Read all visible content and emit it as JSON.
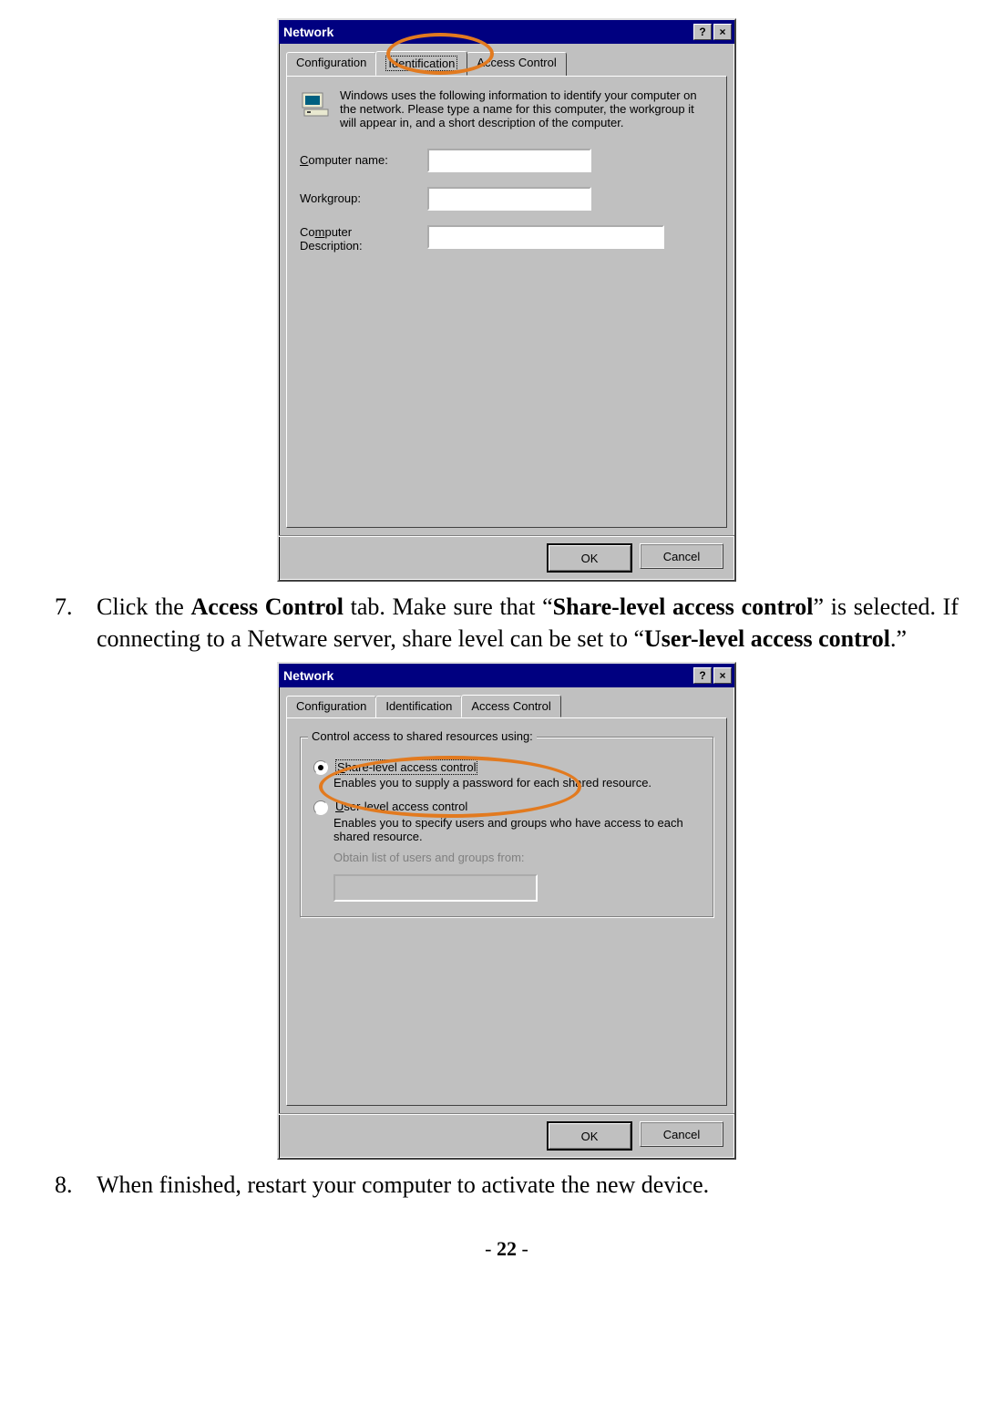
{
  "dlg1": {
    "title": "Network",
    "help_glyph": "?",
    "close_glyph": "×",
    "tabs": {
      "config": "Configuration",
      "ident": "Identification",
      "access": "Access Control"
    },
    "desc": "Windows uses the following information to identify your computer on the network.  Please type a name for this computer, the workgroup it will appear in, and a short description of the computer.",
    "fields": {
      "computer_name_pre": "C",
      "computer_name_rest": "omputer name:",
      "workgroup": "Workgroup:",
      "comp_desc_pre": "Co",
      "comp_desc_u": "m",
      "comp_desc_rest": "puter",
      "comp_desc_line2": "Description:"
    },
    "ok": "OK",
    "cancel": "Cancel"
  },
  "step7": {
    "num": "7.",
    "t1": "Click the ",
    "b1": "Access Control",
    "t2": " tab.   Make sure that “",
    "b2": "Share-level access control",
    "t3": "” is selected.   If connecting to a Netware server, share level can be set to “",
    "b3": "User-level access control",
    "t4": ".”"
  },
  "dlg2": {
    "title": "Network",
    "help_glyph": "?",
    "close_glyph": "×",
    "tabs": {
      "config": "Configuration",
      "ident": "Identification",
      "access": "Access Control"
    },
    "group_legend": "Control access to shared resources using:",
    "share_u": "S",
    "share_rest": "hare-level access control",
    "share_desc": "Enables you to supply a password for each shared resource.",
    "user_u": "U",
    "user_rest": "ser-level access control",
    "user_desc": "Enables you to specify users and groups who have access to each shared resource.",
    "obtain": "Obtain list of users and groups from:",
    "ok": "OK",
    "cancel": "Cancel"
  },
  "step8": {
    "num": "8.",
    "t1": "When finished, restart your computer to activate the new device."
  },
  "footer": {
    "dash1": "- ",
    "num": "22",
    "dash2": " -"
  }
}
